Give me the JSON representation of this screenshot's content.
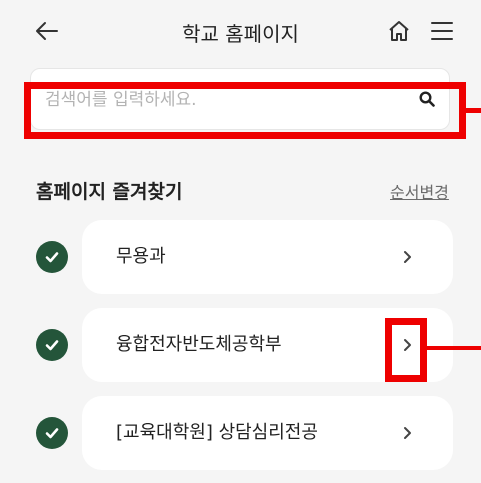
{
  "header": {
    "title": "학교 홈페이지",
    "back_icon": "arrow-left-icon",
    "home_icon": "home-icon",
    "menu_icon": "hamburger-menu-icon"
  },
  "search": {
    "placeholder": "검색어를 입력하세요.",
    "value": "",
    "icon": "search-icon"
  },
  "favorites": {
    "title": "홈페이지 즐겨찾기",
    "reorder_label": "순서변경",
    "items": [
      {
        "label": "무용과",
        "checked": true
      },
      {
        "label": "융합전자반도체공학부",
        "checked": true
      },
      {
        "label": "[교육대학원] 상담심리전공",
        "checked": true
      }
    ]
  },
  "colors": {
    "check_bg": "#24553a",
    "highlight": "#ee0000",
    "background": "#f5f5f5"
  }
}
